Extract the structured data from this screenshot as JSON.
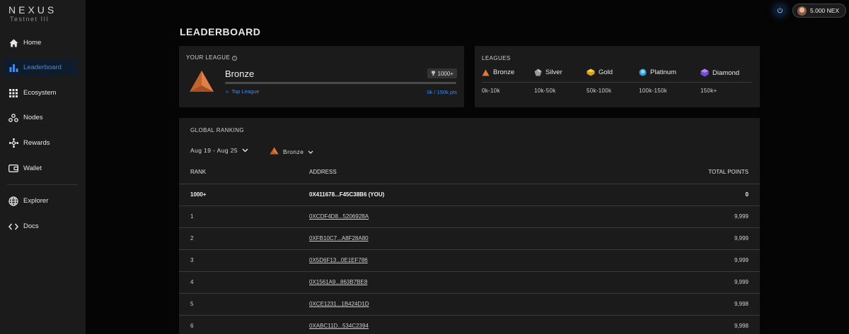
{
  "brand": {
    "name": "NEXUS",
    "network": "Testnet III"
  },
  "sidebar": {
    "items": [
      {
        "label": "Home",
        "icon": "home-icon"
      },
      {
        "label": "Leaderboard",
        "icon": "bar-chart-icon",
        "active": true
      },
      {
        "label": "Ecosystem",
        "icon": "grid-icon"
      },
      {
        "label": "Nodes",
        "icon": "nodes-icon"
      },
      {
        "label": "Rewards",
        "icon": "sparkle-icon"
      },
      {
        "label": "Wallet",
        "icon": "wallet-icon"
      },
      {
        "label": "Explorer",
        "icon": "globe-icon"
      },
      {
        "label": "Docs",
        "icon": "code-icon"
      }
    ]
  },
  "topbar": {
    "balance": "5.000 NEX"
  },
  "page": {
    "title": "LEADERBOARD"
  },
  "your_league": {
    "label": "YOUR LEAGUE",
    "league": "Bronze",
    "rank": "1000+",
    "top_league_link": "Top League",
    "progress_text": "0k / 150k pts",
    "progress_fraction": 0
  },
  "leagues": {
    "label": "LEAGUES",
    "tiers": [
      {
        "name": "Bronze",
        "range": "0k-10k",
        "color": "#e07a3c"
      },
      {
        "name": "Silver",
        "range": "10k-50k",
        "color": "#9a9a9a"
      },
      {
        "name": "Gold",
        "range": "50k-100k",
        "color": "#e8b72a"
      },
      {
        "name": "Platinum",
        "range": "100k-150k",
        "color": "#4fb3e0"
      },
      {
        "name": "Diamond",
        "range": "150k+",
        "color": "#8a5ce6"
      }
    ]
  },
  "global_ranking": {
    "label": "GLOBAL  RANKING",
    "date_filter": "Aug 19 - Aug 25",
    "league_filter": "Bronze",
    "columns": {
      "rank": "RANK",
      "address": "ADDRESS",
      "points": "TOTAL POINTS"
    },
    "rows": [
      {
        "rank": "1000+",
        "address": "0X411678...F45C38B6 (YOU)",
        "points": "0",
        "you": true
      },
      {
        "rank": "1",
        "address": "0XCDF4D8...5206928A",
        "points": "9,999"
      },
      {
        "rank": "2",
        "address": "0XFB10C7...A8F28A80",
        "points": "9,999"
      },
      {
        "rank": "3",
        "address": "0X5D6F13...0E1EF786",
        "points": "9,999"
      },
      {
        "rank": "4",
        "address": "0X1561A9...863B7BE8",
        "points": "9,999"
      },
      {
        "rank": "5",
        "address": "0XCE1231...1B424D1D",
        "points": "9,998"
      },
      {
        "rank": "6",
        "address": "0XABC11D...534C2394",
        "points": "9,998"
      }
    ]
  }
}
